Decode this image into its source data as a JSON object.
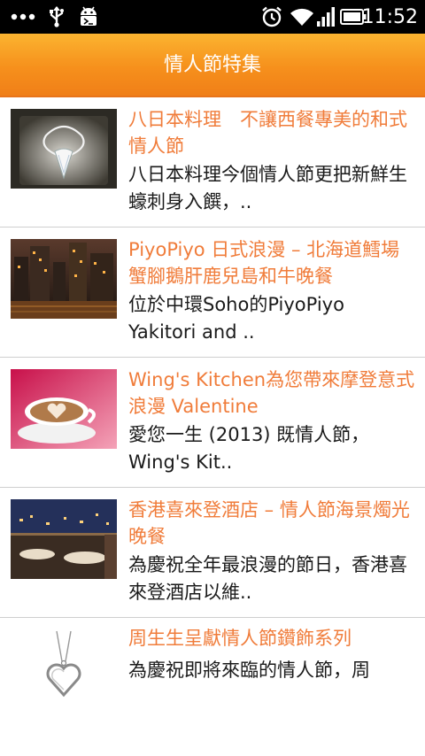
{
  "status_bar": {
    "time": "11:52",
    "left_icons": [
      "more-icon",
      "usb-icon",
      "android-debug-icon"
    ],
    "right_icons": [
      "alarm-icon",
      "wifi-icon",
      "signal-icon",
      "battery-icon"
    ]
  },
  "header": {
    "title": "情人節特集",
    "accent_color": "#f6901c"
  },
  "articles": [
    {
      "title": "八日本料理　不讓西餐專美的和式情人節",
      "desc": "八日本料理今個情人節更把新鮮生蠔刺身入饌，..",
      "thumb_icon": "crystal-heart-ornament-photo"
    },
    {
      "title": "PiyoPiyo 日式浪漫 – 北海道鱈場蟹腳鵝肝鹿兒島和牛晚餐",
      "desc": "位於中環Soho的PiyoPiyo Yakitori and ..",
      "thumb_icon": "city-night-photo"
    },
    {
      "title": "Wing's Kitchen為您帶來摩登意式浪漫 Valentine",
      "desc": "愛您一生 (2013) 既情人節，Wing's Kit..",
      "thumb_icon": "heart-latte-photo"
    },
    {
      "title": "香港喜來登酒店 – 情人節海景燭光晚餐",
      "desc": "為慶祝全年最浪漫的節日，香港喜來登酒店以維..",
      "thumb_icon": "restaurant-view-photo"
    },
    {
      "title": "周生生呈獻情人節鑽飾系列",
      "desc": "為慶祝即將來臨的情人節，周",
      "thumb_icon": "heart-pendant-photo"
    }
  ],
  "colors": {
    "title_text": "#f07c3a",
    "body_text": "#1a1a1a",
    "divider": "#cfcfcf"
  }
}
